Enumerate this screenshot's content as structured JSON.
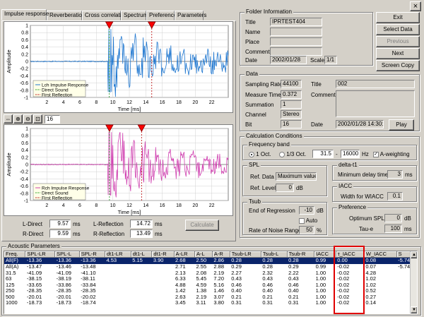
{
  "window": {
    "close_glyph": "×"
  },
  "tabs": [
    {
      "label": "Impulse response"
    },
    {
      "label": "Reverberation"
    },
    {
      "label": "Cross correlation"
    },
    {
      "label": "Spectrum"
    },
    {
      "label": "Preference"
    },
    {
      "label": "Parameters"
    }
  ],
  "chart_data": [
    {
      "type": "line",
      "ylabel": "Amplitude",
      "xlabel": "Time [ms]",
      "xlim": [
        0,
        24
      ],
      "ylim": [
        -1,
        1
      ],
      "xticks": [
        "2",
        "4",
        "6",
        "8",
        "10",
        "12",
        "14",
        "16",
        "18",
        "20",
        "22"
      ],
      "yticks": [
        "1",
        "0.8",
        "0.6",
        "0.4",
        "0.2",
        "0",
        "-0.2",
        "-0.4",
        "-0.6",
        "-0.8",
        "-1"
      ],
      "legend": [
        "Lch Impulse Response",
        "Direct Sound",
        "First Reflection"
      ],
      "markers": {
        "direct_ms": 9.57,
        "reflection_ms": 14.72
      },
      "series": [
        {
          "name": "Lch Impulse Response",
          "color": "#1f77d0"
        }
      ]
    },
    {
      "type": "line",
      "ylabel": "Amplitude",
      "xlabel": "Time [ms]",
      "xlim": [
        0,
        24
      ],
      "ylim": [
        -1,
        1
      ],
      "xticks": [
        "2",
        "4",
        "6",
        "8",
        "10",
        "12",
        "14",
        "16",
        "18",
        "20",
        "22"
      ],
      "yticks": [
        "1",
        "0.8",
        "0.6",
        "0.4",
        "0.2",
        "0",
        "-0.2",
        "-0.4",
        "-0.6",
        "-0.8",
        "-1"
      ],
      "legend": [
        "Rch Impulse Response",
        "Direct Sound",
        "First Reflection"
      ],
      "markers": {
        "direct_ms": 9.59,
        "reflection_ms": 13.49
      },
      "series": [
        {
          "name": "Rch Impulse Response",
          "color": "#d040b0"
        }
      ]
    }
  ],
  "zoom": {
    "value": "16"
  },
  "readouts": {
    "l_direct_label": "L-Direct",
    "l_direct": "9.57",
    "r_direct_label": "R-Direct",
    "r_direct": "9.59",
    "l_refl_label": "L-Reflection",
    "l_refl": "14.72",
    "r_refl_label": "R-Reflection",
    "r_refl": "13.49",
    "unit": "ms",
    "calculate": "Calculate"
  },
  "folder": {
    "title": "Folder Information",
    "fields": [
      {
        "label": "Title",
        "value": "IPRTEST404"
      },
      {
        "label": "Name",
        "value": ""
      },
      {
        "label": "Place",
        "value": ""
      },
      {
        "label": "Comment",
        "value": ""
      }
    ],
    "date_label": "Date",
    "date": "2002/01/28",
    "scale_label": "Scale",
    "scale": "1/1"
  },
  "buttons": {
    "exit": "Exit",
    "select": "Select Data",
    "previous": "Previous",
    "next": "Next",
    "copy": "Screen Copy"
  },
  "data_box": {
    "title": "Data",
    "sampling_label": "Sampling Rate",
    "sampling": "44100",
    "measure_label": "Measure Time",
    "measure": "0.372",
    "summation_label": "Summation",
    "summation": "1",
    "channel_label": "Channel",
    "channel": "Stereo",
    "bit_label": "Bit",
    "bit": "16",
    "title_label": "Title",
    "title_val": "002",
    "comment_label": "Comment",
    "date_label": "Date",
    "date": "2002/01/28 14:30:41",
    "play": "Play"
  },
  "calc": {
    "title": "Calculation Conditions",
    "freq_title": "Frequency band",
    "oct1": "1 Oct.",
    "oct3": "1/3 Oct.",
    "f_low": "31.5",
    "dash": "-",
    "f_high": "16000",
    "hz": "Hz",
    "aweight": "A-weighting",
    "spl_title": "SPL",
    "ref_data_label": "Ref. Data",
    "ref_data": "Maximum value",
    "ref_level_label": "Ref. Level",
    "ref_level": "0",
    "db": "dB",
    "delta_title": "delta-t1",
    "min_delay_label": "Minimum delay time",
    "min_delay": "3",
    "ms": "ms",
    "iacc_title": "IACC",
    "wiacc_label": "Width for WIACC",
    "wiacc": "0.1",
    "tsub_title": "Tsub",
    "end_reg_label": "End of Regression",
    "end_reg": "-10",
    "auto": "Auto",
    "rate_label": "Rate of Noise Range",
    "rate": "50",
    "pct": "%",
    "pref_title": "Preference",
    "opt_spl_label": "Optimum SPL",
    "opt_spl": "0",
    "tau_label": "Tau-e",
    "tau": "100"
  },
  "acoustic": {
    "title": "Acoustic Parameters",
    "columns": [
      "Freq.",
      "SPL-LR",
      "SPL-L",
      "SPL-R",
      "dt1-LR",
      "dt1-L",
      "dt1-R",
      "A-LR",
      "A-L",
      "A-R",
      "Tsub-LR",
      "Tsub-L",
      "Tsub-R",
      "IACC",
      "τ_IACC",
      "W_IACC",
      "S"
    ],
    "rows": [
      [
        "All(F)",
        "-13.36",
        "-13.36",
        "-13.36",
        "4.53",
        "5.15",
        "3.90",
        "2.68",
        "2.50",
        "2.86",
        "0.28",
        "0.28",
        "0.28",
        "0.99",
        "0.00",
        "0.08",
        "-5.74"
      ],
      [
        "All(A)",
        "-13.47",
        "-13.46",
        "-13.48",
        "",
        "",
        "",
        "2.71",
        "2.55",
        "2.88",
        "0.29",
        "0.28",
        "0.29",
        "0.99",
        "-0.02",
        "0.07",
        "-5.74"
      ],
      [
        "31.5",
        "-41.09",
        "-41.09",
        "-41.10",
        "",
        "",
        "",
        "2.13",
        "2.08",
        "2.19",
        "2.27",
        "2.32",
        "2.22",
        "1.00",
        "-0.02",
        "4.28",
        ""
      ],
      [
        "63",
        "-38.15",
        "-38.19",
        "-38.11",
        "",
        "",
        "",
        "6.33",
        "5.45",
        "7.20",
        "0.43",
        "0.43",
        "0.43",
        "1.00",
        "-0.02",
        "1.02",
        ""
      ],
      [
        "125",
        "-33.65",
        "-33.86",
        "-33.84",
        "",
        "",
        "",
        "4.88",
        "4.59",
        "5.16",
        "0.46",
        "0.46",
        "0.46",
        "1.00",
        "-0.02",
        "1.02",
        ""
      ],
      [
        "250",
        "-28.35",
        "-28.35",
        "-28.35",
        "",
        "",
        "",
        "1.42",
        "1.38",
        "1.46",
        "0.40",
        "0.40",
        "0.40",
        "1.00",
        "-0.02",
        "0.52",
        ""
      ],
      [
        "500",
        "-20.01",
        "-20.01",
        "-20.02",
        "",
        "",
        "",
        "2.63",
        "2.19",
        "3.07",
        "0.21",
        "0.21",
        "0.21",
        "1.00",
        "-0.02",
        "0.27",
        ""
      ],
      [
        "1000",
        "-18.73",
        "-18.73",
        "-18.74",
        "",
        "",
        "",
        "3.45",
        "3.11",
        "3.80",
        "0.31",
        "0.31",
        "0.31",
        "1.00",
        "-0.02",
        "0.14",
        ""
      ]
    ]
  }
}
